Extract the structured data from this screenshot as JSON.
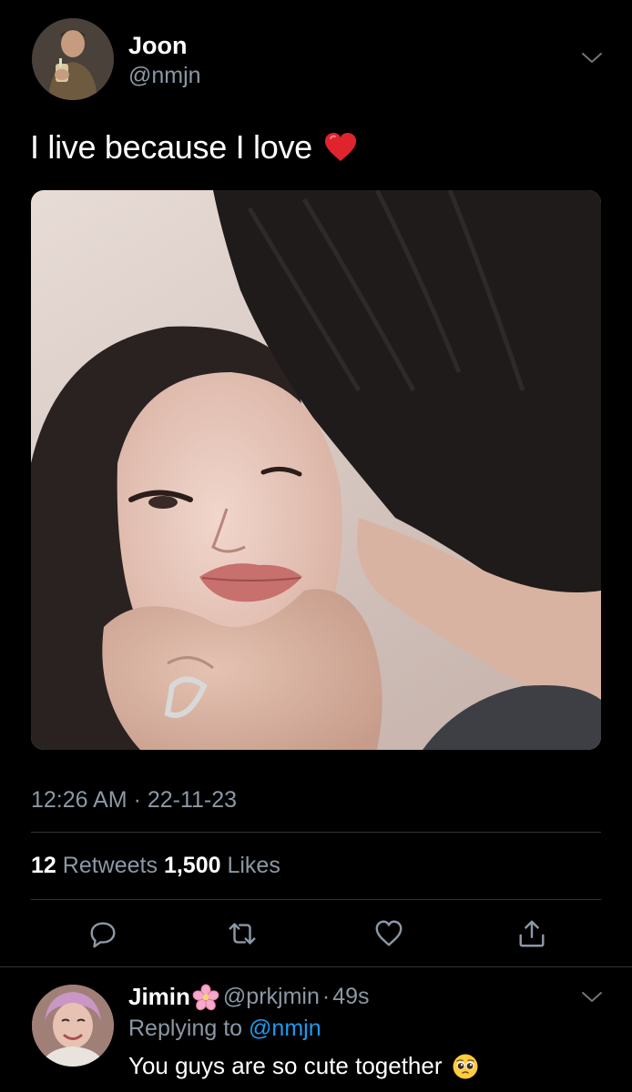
{
  "tweet": {
    "author": {
      "display_name": "Joon",
      "handle": "@nmjn",
      "avatar_icon": "user-avatar"
    },
    "text": "I live because I love",
    "emoji": "red-heart",
    "timestamp": "12:26 AM · 22-11-23",
    "stats": {
      "retweets_count": "12",
      "retweets_label": "Retweets",
      "likes_count": "1,500",
      "likes_label": "Likes"
    },
    "actions": [
      {
        "name": "reply",
        "icon": "reply-icon"
      },
      {
        "name": "retweet",
        "icon": "retweet-icon"
      },
      {
        "name": "like",
        "icon": "heart-icon"
      },
      {
        "name": "share",
        "icon": "share-icon"
      }
    ]
  },
  "reply": {
    "author": {
      "display_name": "Jimin",
      "emoji": "cherry-blossom",
      "handle": "@prkjmin",
      "separator": "·",
      "time": "49s"
    },
    "replying_prefix": "Replying to",
    "replying_to": "@nmjn",
    "text": "You guys are so cute together",
    "text_emoji": "pleading-face"
  },
  "colors": {
    "background": "#000000",
    "primary_text": "#ffffff",
    "secondary_text": "#8b98a5",
    "link": "#1d9bf0",
    "divider": "#2f3336"
  }
}
